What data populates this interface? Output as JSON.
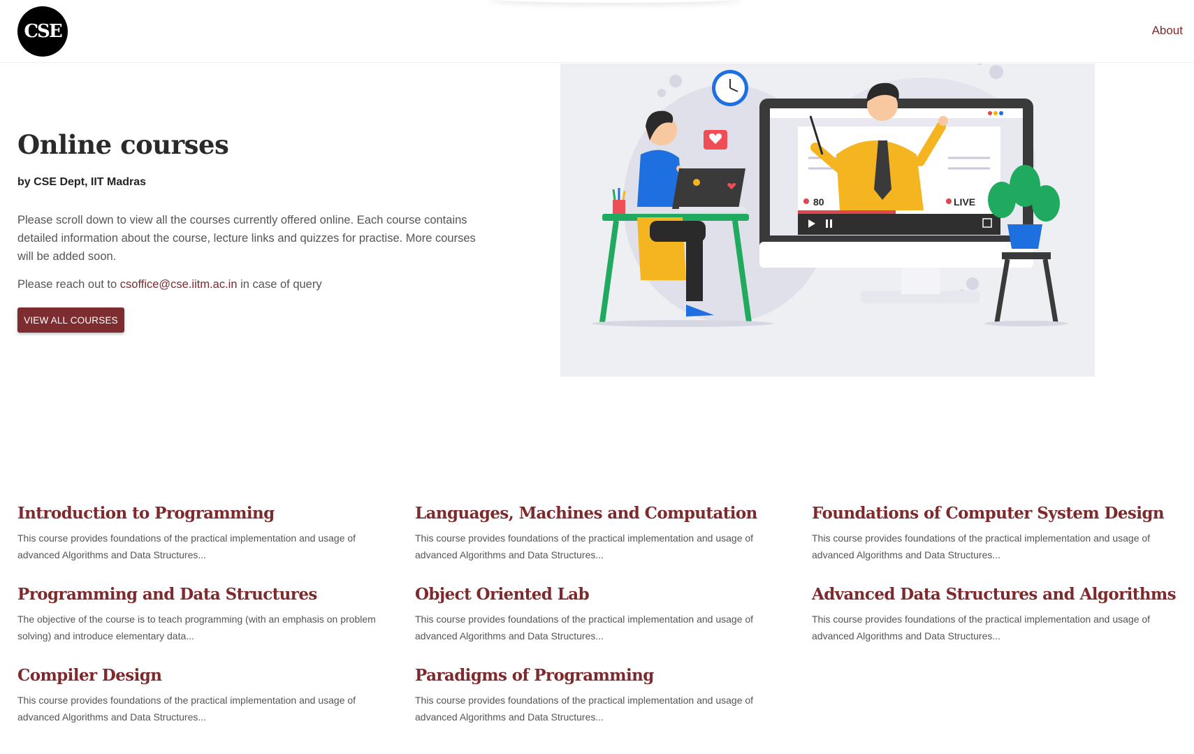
{
  "header": {
    "logo_alt": "CSE IITM",
    "logo_text": "CSE",
    "nav_about": "About"
  },
  "hero": {
    "title": "Online courses",
    "subtitle": "by CSE Dept, IIT Madras",
    "description": "Please scroll down to view all the courses currently offered online. Each course contains detailed information about the course, lecture links and quizzes for practise. More courses will be added soon.",
    "contact_prefix": "Please reach out to",
    "contact_email": "csoffice@cse.iitm.ac.in",
    "contact_suffix": "in case of query",
    "button_label": "VIEW ALL COURSES"
  },
  "illustration": {
    "viewer_count": "80",
    "live_label": "LIVE"
  },
  "courses": [
    {
      "title": "Introduction to Programming",
      "desc": "This course provides foundations of the practical implementation and usage of advanced Algorithms and Data Structures..."
    },
    {
      "title": "Languages, Machines and Computation",
      "desc": "This course provides foundations of the practical implementation and usage of advanced Algorithms and Data Structures..."
    },
    {
      "title": "Foundations of Computer System Design",
      "desc": "This course provides foundations of the practical implementation and usage of advanced Algorithms and Data Structures..."
    },
    {
      "title": "Programming and Data Structures",
      "desc": "The objective of the course is to teach programming (with an emphasis on problem solving) and introduce elementary data..."
    },
    {
      "title": "Object Oriented Lab",
      "desc": "This course provides foundations of the practical implementation and usage of advanced Algorithms and Data Structures..."
    },
    {
      "title": "Advanced Data Structures and Algorithms",
      "desc": "This course provides foundations of the practical implementation and usage of advanced Algorithms and Data Structures..."
    },
    {
      "title": "Compiler Design",
      "desc": "This course provides foundations of the practical implementation and usage of advanced Algorithms and Data Structures..."
    },
    {
      "title": "Paradigms of Programming",
      "desc": "This course provides foundations of the practical implementation and usage of advanced Algorithms and Data Structures..."
    }
  ]
}
